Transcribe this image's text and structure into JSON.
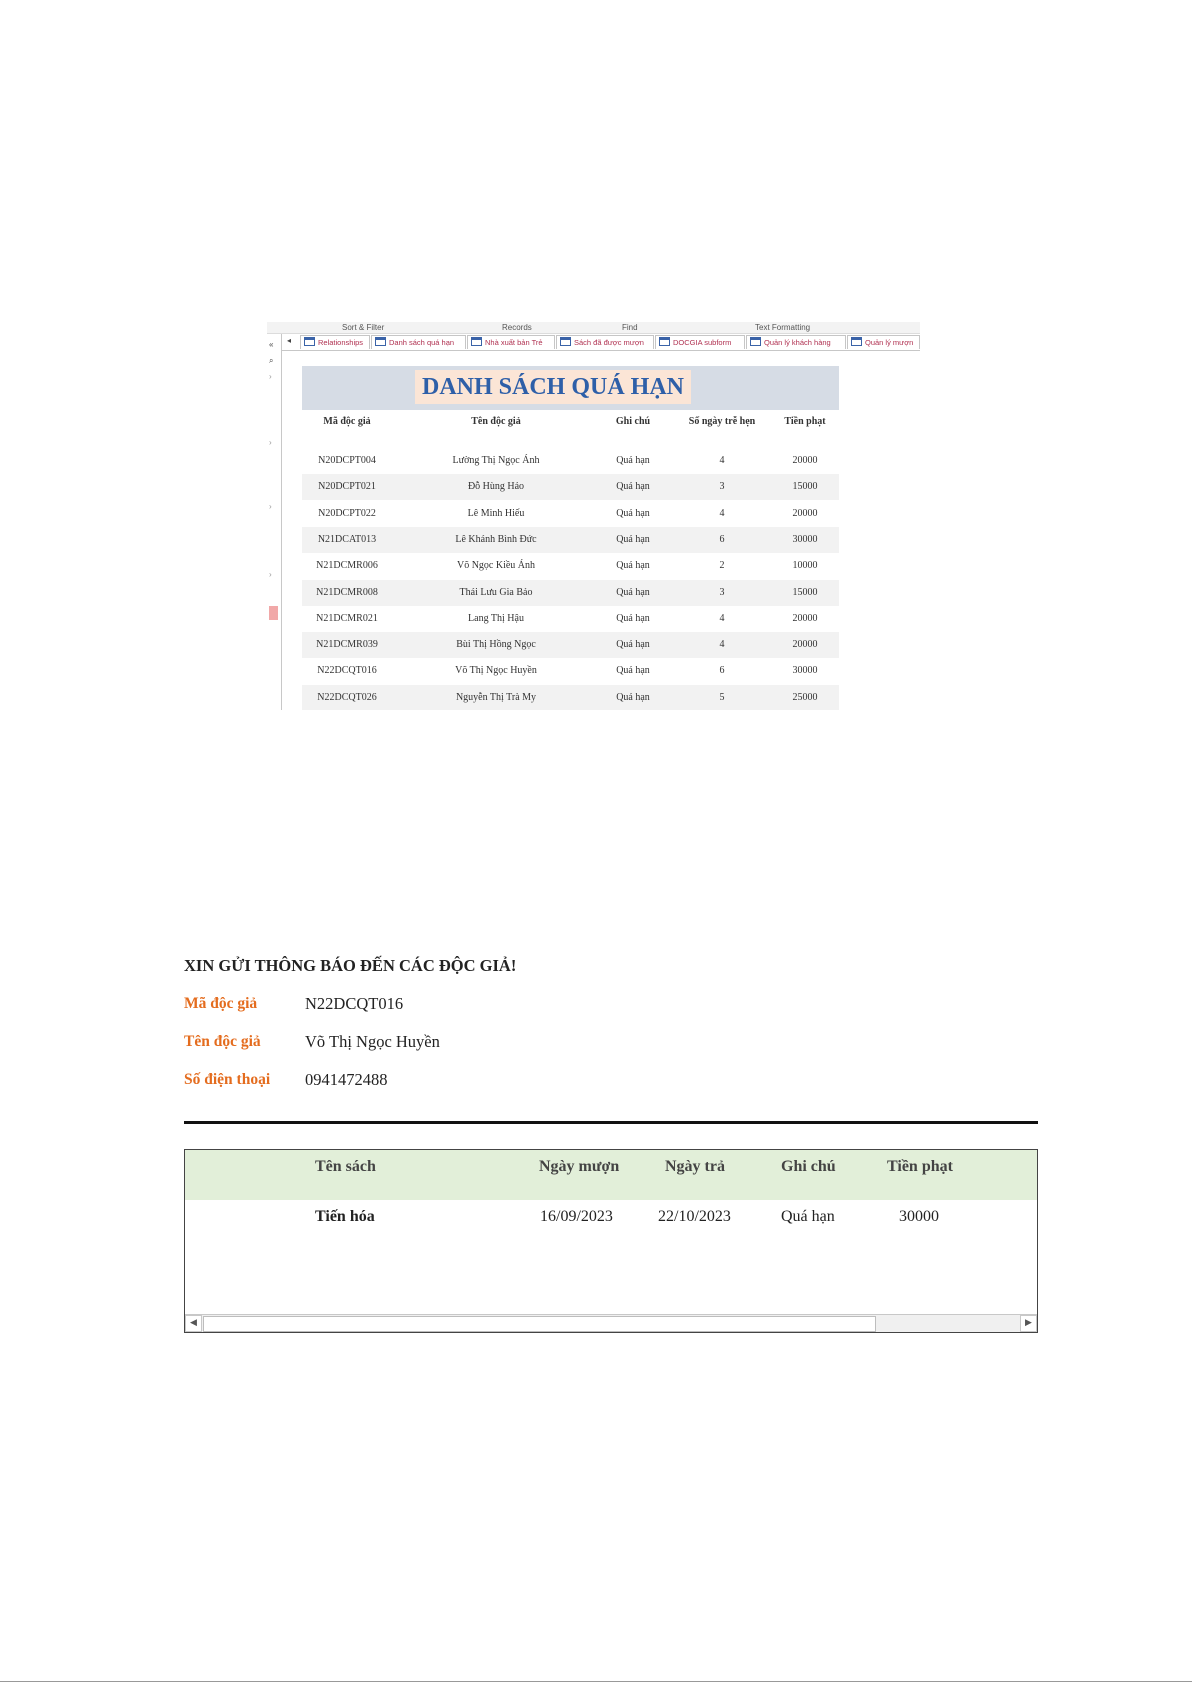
{
  "access": {
    "ribbon_groups": [
      "Sort & Filter",
      "Records",
      "Find",
      "Text Formatting"
    ],
    "tabs": [
      "Relationships",
      "Danh sách quá hạn",
      "Nhà xuất bản Trẻ",
      "Sách đã được mượn",
      "DOCGIA subform",
      "Quản lý khách hàng",
      "Quản lý mượn"
    ],
    "report": {
      "title": "DANH SÁCH QUÁ HẠN",
      "columns": [
        "Mã độc giả",
        "Tên độc giả",
        "Ghi chú",
        "Số ngày trễ hẹn",
        "Tiền phạt"
      ],
      "rows": [
        [
          "N20DCPT004",
          "Lường Thị Ngọc Ánh",
          "Quá hạn",
          "4",
          "20000"
        ],
        [
          "N20DCPT021",
          "Đỗ Hùng Hảo",
          "Quá hạn",
          "3",
          "15000"
        ],
        [
          "N20DCPT022",
          "Lê Minh Hiếu",
          "Quá hạn",
          "4",
          "20000"
        ],
        [
          "N21DCAT013",
          "Lê Khánh Bình Đức",
          "Quá hạn",
          "6",
          "30000"
        ],
        [
          "N21DCMR006",
          "Võ Ngọc Kiều Ánh",
          "Quá hạn",
          "2",
          "10000"
        ],
        [
          "N21DCMR008",
          "Thái Lưu Gia Bảo",
          "Quá hạn",
          "3",
          "15000"
        ],
        [
          "N21DCMR021",
          "Lang Thị Hậu",
          "Quá hạn",
          "4",
          "20000"
        ],
        [
          "N21DCMR039",
          "Bùi Thị Hồng Ngọc",
          "Quá hạn",
          "4",
          "20000"
        ],
        [
          "N22DCQT016",
          "Võ Thị Ngọc Huyền",
          "Quá hạn",
          "6",
          "30000"
        ],
        [
          "N22DCQT026",
          "Nguyễn Thị Trà My",
          "Quá hạn",
          "5",
          "25000"
        ]
      ]
    }
  },
  "notice": {
    "title": "XIN GỬI THÔNG BÁO ĐẾN CÁC ĐỘC GIẢ!",
    "fields": [
      {
        "label": "Mã độc giả",
        "value": "N22DCQT016"
      },
      {
        "label": "Tên độc giả",
        "value": "Võ Thị Ngọc Huyền"
      },
      {
        "label": "Số điện thoại",
        "value": "0941472488"
      }
    ],
    "subform": {
      "columns": [
        "Tên sách",
        "Ngày mượn",
        "Ngày trả",
        "Ghi chú",
        "Tiền phạt"
      ],
      "rows": [
        [
          "Tiến hóa",
          "16/09/2023",
          "22/10/2023",
          "Quá hạn",
          "30000"
        ]
      ]
    }
  },
  "colors": {
    "accent_label": "#e46c1e",
    "report_title": "#2e5fa8",
    "subform_header": "#e2efd9"
  }
}
